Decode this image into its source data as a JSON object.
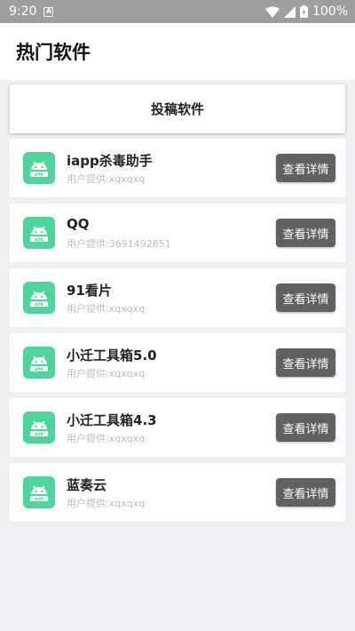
{
  "status_bar": {
    "time": "9:20",
    "notification_badge": "A",
    "battery_text": "100%"
  },
  "app_bar": {
    "title": "热门软件"
  },
  "submit": {
    "label": "投稿软件"
  },
  "apps": [
    {
      "name": "iapp杀毒助手",
      "provider": "用户提供:xqxqxq",
      "button": "查看详情"
    },
    {
      "name": "QQ",
      "provider": "用户提供:3691492851",
      "button": "查看详情"
    },
    {
      "name": "91看片",
      "provider": "用户提供:xqxqxq",
      "button": "查看详情"
    },
    {
      "name": "小迁工具箱5.0",
      "provider": "用户提供:xqxqxq",
      "button": "查看详情"
    },
    {
      "name": "小迁工具箱4.3",
      "provider": "用户提供:xqxqxq",
      "button": "查看详情"
    },
    {
      "name": "蓝奏云",
      "provider": "用户提供:xqxqxq",
      "button": "查看详情"
    }
  ],
  "icons": {
    "app_icon": "android-apk-icon",
    "wifi": "wifi-icon",
    "signal": "signal-icon",
    "battery": "battery-charging-icon"
  },
  "colors": {
    "app_icon_bg": "#4cd69b",
    "button_bg": "#616161",
    "status_bar_bg": "#9e9e9e",
    "page_bg": "#efeff4"
  }
}
